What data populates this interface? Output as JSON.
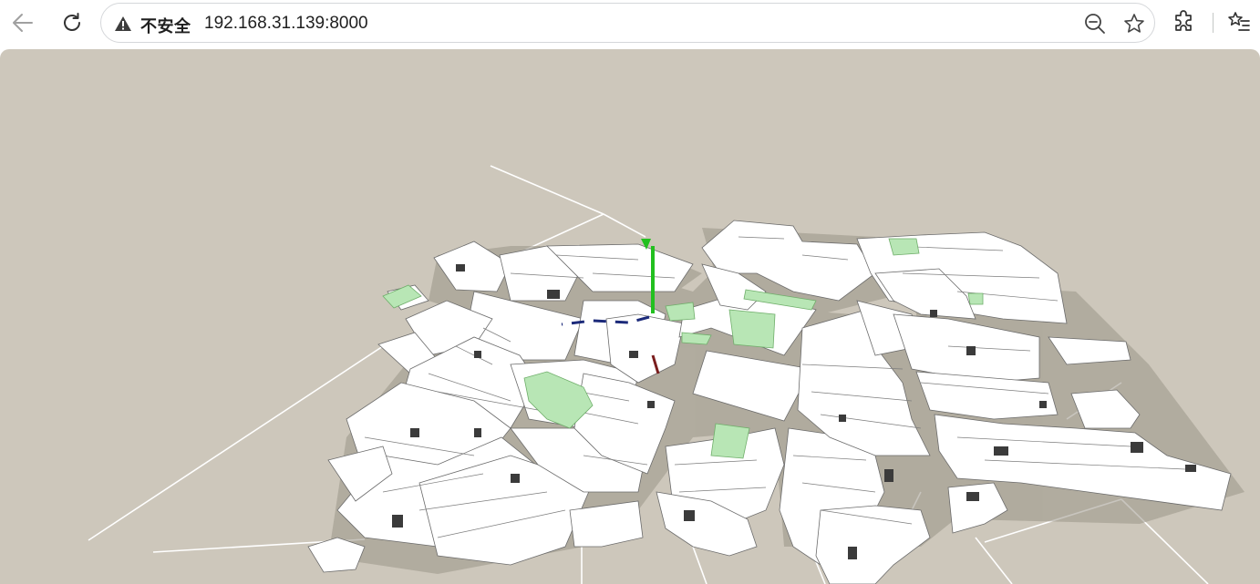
{
  "browser": {
    "security_label": "不安全",
    "url": "192.168.31.139:8000",
    "icons": {
      "back": "arrow-left-icon",
      "reload": "reload-icon",
      "warning": "warning-triangle-icon",
      "zoom": "zoom-out-icon",
      "bookmark": "star-icon",
      "extensions": "puzzle-piece-icon",
      "favorites": "favorites-list-icon"
    }
  },
  "scene": {
    "background_color": "#cdc7bb",
    "building_color": "#ffffff",
    "park_color": "#b8e6b5",
    "axis_colors": {
      "y": "#22c01f",
      "z": "#1c2a7a",
      "x": "#7a1d1d"
    }
  }
}
